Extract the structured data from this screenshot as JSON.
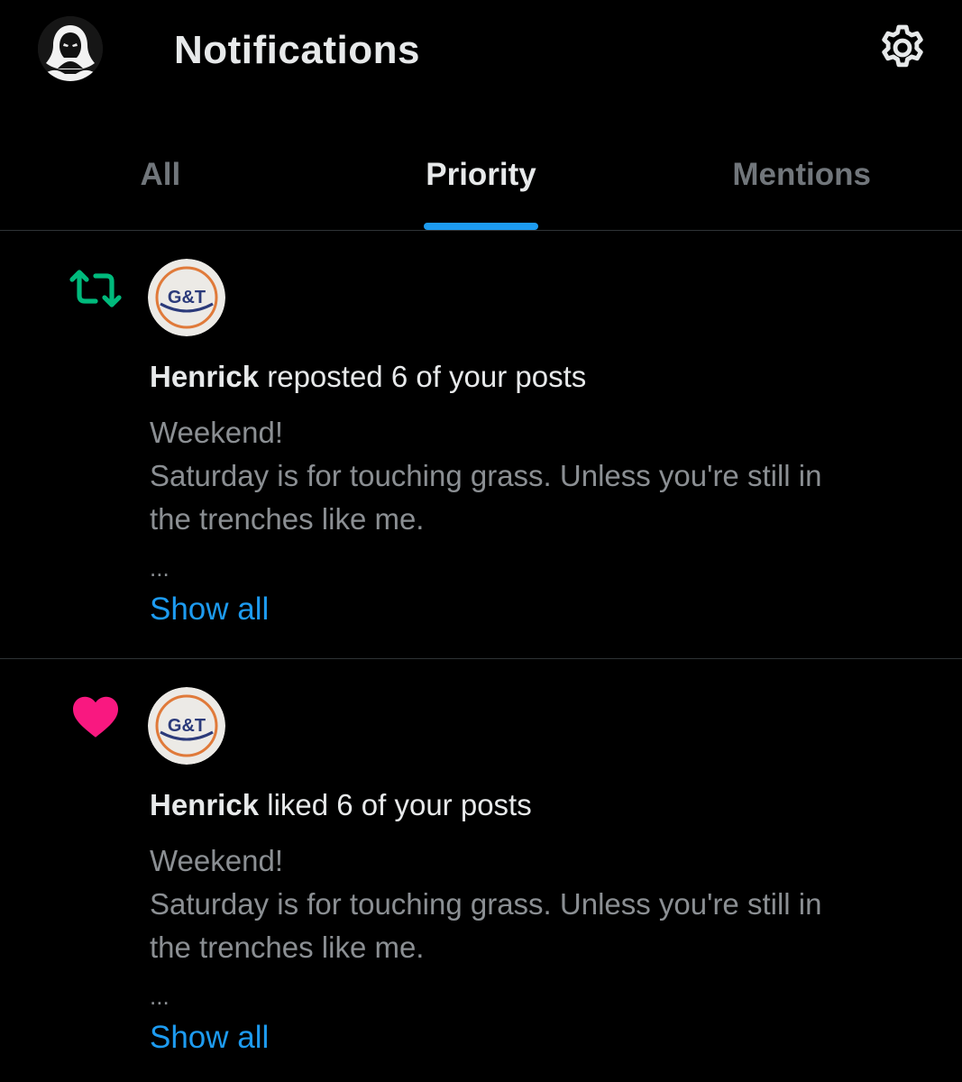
{
  "header": {
    "title": "Notifications",
    "avatar_icon": "hooded-figure-avatar",
    "settings_icon": "gear-icon"
  },
  "tabs": [
    {
      "label": "All",
      "active": false
    },
    {
      "label": "Priority",
      "active": true
    },
    {
      "label": "Mentions",
      "active": false
    }
  ],
  "notifications": [
    {
      "type": "repost",
      "type_icon": "repost-icon",
      "type_color": "#00ba7c",
      "avatar_text": "G&T",
      "user": "Henrick",
      "action": " reposted 6 of your posts",
      "post_lines": [
        "Weekend!",
        "Saturday is for touching grass. Unless you're still in",
        "the  trenches like me."
      ],
      "ellipsis": "...",
      "show_all": "Show all"
    },
    {
      "type": "like",
      "type_icon": "heart-icon",
      "type_color": "#f91880",
      "avatar_text": "G&T",
      "user": "Henrick",
      "action": " liked 6 of your posts",
      "post_lines": [
        "Weekend!",
        "Saturday is for touching grass. Unless you're still in",
        "the  trenches like me."
      ],
      "ellipsis": "...",
      "show_all": "Show all"
    }
  ],
  "colors": {
    "accent": "#1d9bf0",
    "background": "#000000",
    "muted_text": "#71767b",
    "divider": "#2f3336"
  }
}
